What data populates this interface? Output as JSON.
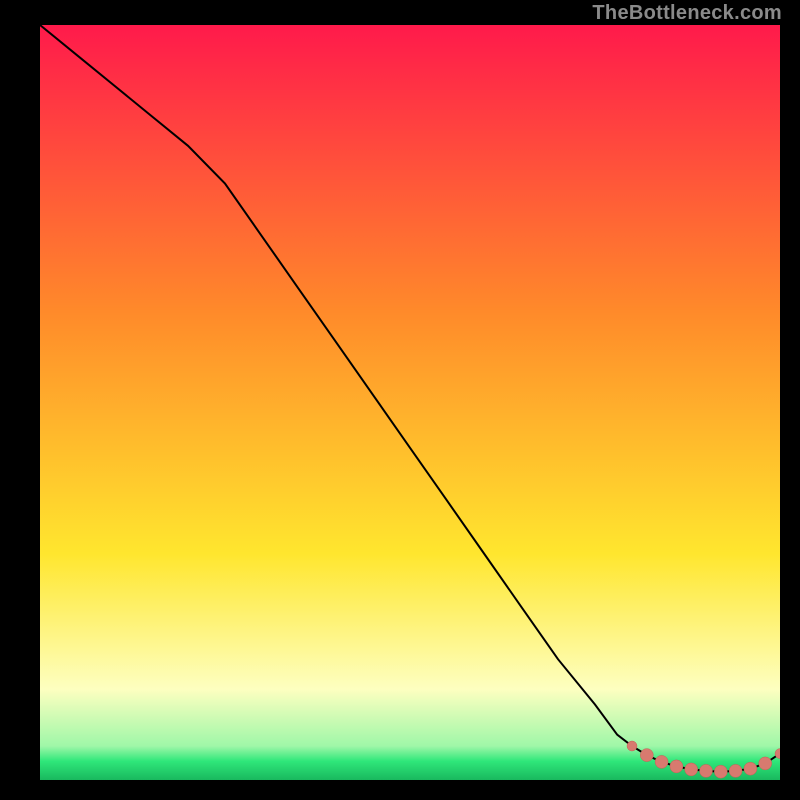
{
  "watermark": "TheBottleneck.com",
  "colors": {
    "background": "#000000",
    "watermark": "#8a8a8a",
    "curve": "#000000",
    "marker_fill": "#d87a6f",
    "marker_stroke": "#c46055",
    "gradient_top": "#ff1a4b",
    "gradient_mid1": "#ff8a2a",
    "gradient_mid2": "#ffe62e",
    "gradient_pale": "#fdffc0",
    "gradient_green": "#2fe77a"
  },
  "chart_data": {
    "type": "line",
    "title": "",
    "xlabel": "",
    "ylabel": "",
    "xlim": [
      0,
      100
    ],
    "ylim": [
      0,
      100
    ],
    "series": [
      {
        "name": "bottleneck-curve",
        "x": [
          0,
          5,
          10,
          15,
          20,
          25,
          30,
          35,
          40,
          45,
          50,
          55,
          60,
          65,
          70,
          75,
          78,
          80,
          82,
          84,
          86,
          88,
          90,
          92,
          94,
          96,
          98,
          100
        ],
        "y": [
          100,
          96,
          92,
          88,
          84,
          79,
          72,
          65,
          58,
          51,
          44,
          37,
          30,
          23,
          16,
          10,
          6,
          4.5,
          3.3,
          2.4,
          1.8,
          1.4,
          1.2,
          1.1,
          1.2,
          1.5,
          2.2,
          3.5
        ]
      }
    ],
    "markers": {
      "name": "highlighted-range",
      "x": [
        80,
        82,
        84,
        86,
        88,
        90,
        92,
        94,
        96,
        98,
        100
      ],
      "y": [
        4.5,
        3.3,
        2.4,
        1.8,
        1.4,
        1.2,
        1.1,
        1.2,
        1.5,
        2.2,
        3.5
      ]
    },
    "background_gradient_stops": [
      {
        "offset": 0.0,
        "color": "#ff1a4b"
      },
      {
        "offset": 0.38,
        "color": "#ff8a2a"
      },
      {
        "offset": 0.7,
        "color": "#ffe62e"
      },
      {
        "offset": 0.88,
        "color": "#fdffc0"
      },
      {
        "offset": 0.955,
        "color": "#9ff7a8"
      },
      {
        "offset": 0.975,
        "color": "#2fe77a"
      },
      {
        "offset": 1.0,
        "color": "#19b85e"
      }
    ]
  }
}
